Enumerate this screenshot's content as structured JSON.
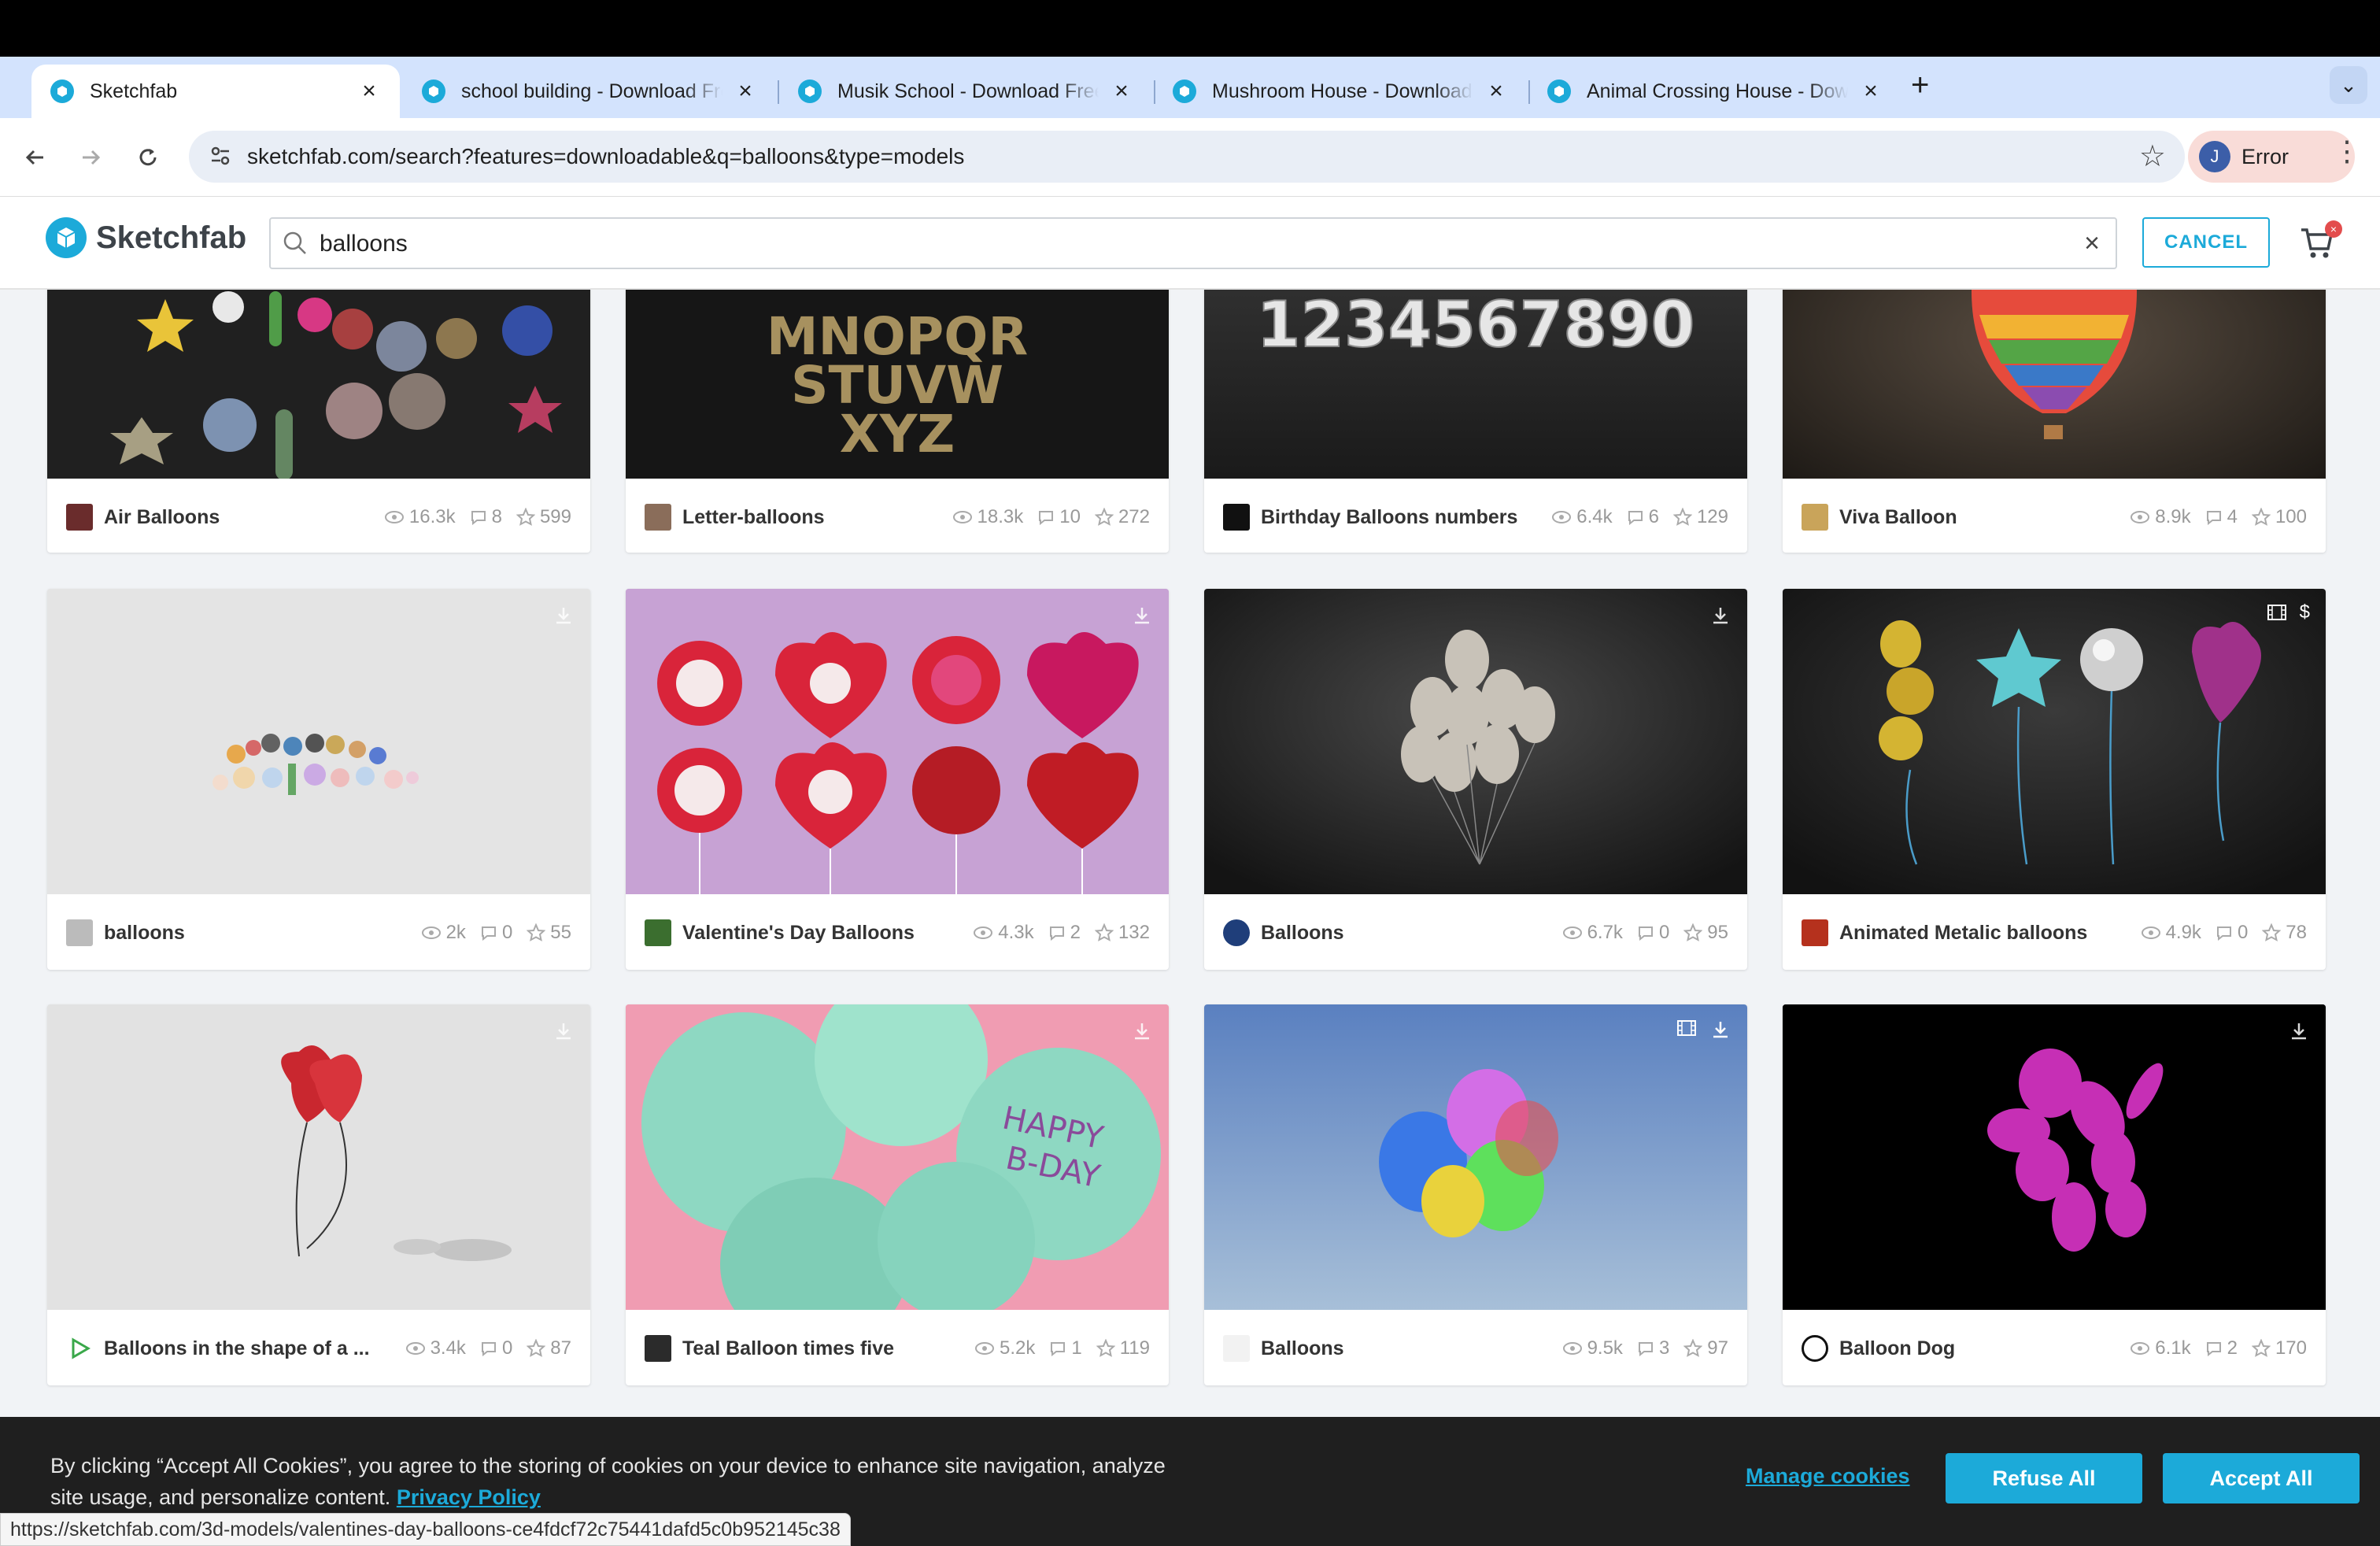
{
  "browser": {
    "tabs": [
      {
        "title": "Sketchfab",
        "active": true
      },
      {
        "title": "school building - Download Free",
        "active": false
      },
      {
        "title": "Musik School - Download Free",
        "active": false
      },
      {
        "title": "Mushroom House - Download",
        "active": false
      },
      {
        "title": "Animal Crossing House - Down",
        "active": false
      }
    ],
    "url": "sketchfab.com/search?features=downloadable&q=balloons&type=models",
    "profile_initial": "J",
    "profile_label": "Error",
    "status_url": "https://sketchfab.com/3d-models/valentines-day-balloons-ce4fdcf72c75441dafd5c0b952145c38"
  },
  "site": {
    "logo_text": "Sketchfab",
    "search_value": "balloons",
    "cancel_label": "CANCEL",
    "cart_badge": "×",
    "accent": "#1caad9"
  },
  "models": [
    {
      "title": "Air Balloons",
      "views": "16.3k",
      "comments": "8",
      "likes": "599"
    },
    {
      "title": "Letter-balloons",
      "views": "18.3k",
      "comments": "10",
      "likes": "272"
    },
    {
      "title": "Birthday Balloons numbers",
      "views": "6.4k",
      "comments": "6",
      "likes": "129"
    },
    {
      "title": "Viva Balloon",
      "views": "8.9k",
      "comments": "4",
      "likes": "100"
    },
    {
      "title": "balloons",
      "views": "2k",
      "comments": "0",
      "likes": "55"
    },
    {
      "title": "Valentine's Day Balloons",
      "views": "4.3k",
      "comments": "2",
      "likes": "132"
    },
    {
      "title": "Balloons",
      "views": "6.7k",
      "comments": "0",
      "likes": "95"
    },
    {
      "title": "Animated Metalic balloons",
      "views": "4.9k",
      "comments": "0",
      "likes": "78"
    },
    {
      "title": "Balloons in the shape of a ...",
      "views": "3.4k",
      "comments": "0",
      "likes": "87"
    },
    {
      "title": "Teal Balloon times five",
      "views": "5.2k",
      "comments": "1",
      "likes": "119"
    },
    {
      "title": "Balloons",
      "views": "9.5k",
      "comments": "3",
      "likes": "97"
    },
    {
      "title": "Balloon Dog",
      "views": "6.1k",
      "comments": "2",
      "likes": "170"
    }
  ],
  "thumb_text": {
    "letters": [
      "MNOPQR",
      "STUVW",
      "XYZ"
    ],
    "numbers": "1234567890",
    "happy_bday": [
      "HAPPY",
      "B-DAY"
    ]
  },
  "cookie": {
    "text": "By clicking “Accept All Cookies”, you agree to the storing of cookies on your device to enhance site navigation, analyze site usage, and personalize content.",
    "privacy_link": "Privacy Policy",
    "manage": "Manage cookies",
    "refuse": "Refuse All",
    "accept": "Accept All"
  }
}
